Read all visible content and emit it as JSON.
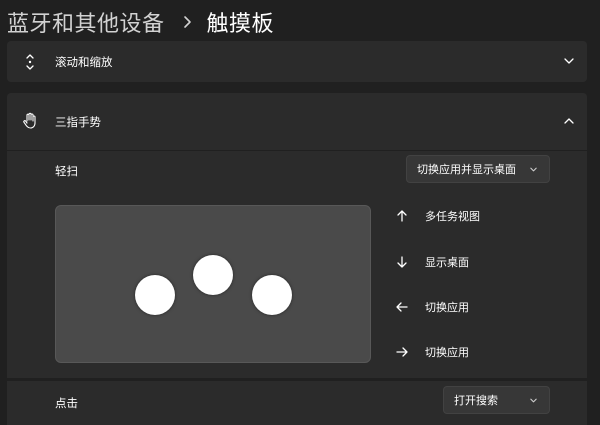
{
  "breadcrumb": {
    "parent": "蓝牙和其他设备",
    "current": "触摸板"
  },
  "sections": {
    "scroll_zoom": {
      "label": "滚动和缩放",
      "icon": "scroll-arrows-icon",
      "expanded": false
    },
    "three_finger": {
      "label": "三指手势",
      "icon": "hand-pointer-icon",
      "expanded": true,
      "swipe": {
        "label": "轻扫",
        "selected": "切换应用并显示桌面"
      },
      "gestures": [
        {
          "direction": "up",
          "label": "多任务视图"
        },
        {
          "direction": "down",
          "label": "显示桌面"
        },
        {
          "direction": "left",
          "label": "切换应用"
        },
        {
          "direction": "right",
          "label": "切换应用"
        }
      ],
      "tap": {
        "label": "点击",
        "selected": "打开搜索"
      }
    }
  },
  "colors": {
    "background": "#202020",
    "card": "#2b2b2b",
    "touchpad": "#4a4a4a",
    "dropdown": "#373737"
  }
}
